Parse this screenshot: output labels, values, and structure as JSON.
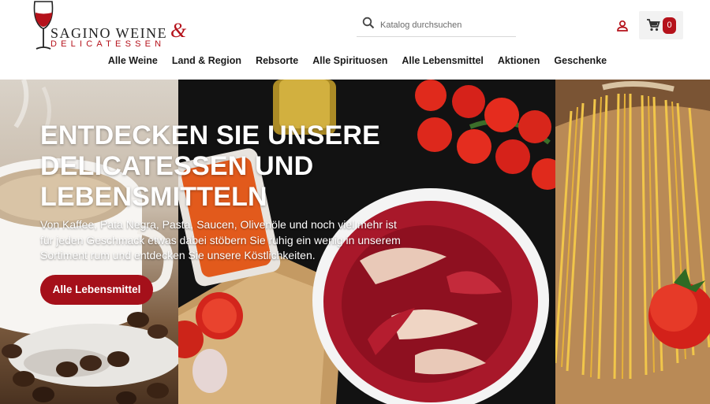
{
  "brand": {
    "name_line1": "SAGINO WEINE",
    "ampersand": "&",
    "name_line2": "DELICATESSEN",
    "colors": {
      "accent": "#b5121b",
      "dark": "#222222"
    }
  },
  "search": {
    "placeholder": "Katalog durchsuchen",
    "icon": "search-icon"
  },
  "account": {
    "icon": "user-icon"
  },
  "cart": {
    "icon": "shopping-cart-icon",
    "count": "0"
  },
  "nav": {
    "items": [
      {
        "label": "Alle Weine"
      },
      {
        "label": "Land & Region"
      },
      {
        "label": "Rebsorte"
      },
      {
        "label": "Alle Spirituosen"
      },
      {
        "label": "Alle Lebensmittel"
      },
      {
        "label": "Aktionen"
      },
      {
        "label": "Geschenke"
      }
    ]
  },
  "hero": {
    "title": "ENTDECKEN SIE UNSERE DELICATESSEN UND LEBENSMITTELN",
    "subtitle": "Von Kaffee, Pata Negra, Pasta, Saucen, Olivenöle und noch viel mehr ist für jeden Geschmack etwas dabei stöbern Sie ruhig ein wenig in unserem Sortiment rum und entdecken Sie unsere Köstlichkeiten.",
    "button_label": "Alle Lebensmittel",
    "button_color": "#a5101a"
  }
}
